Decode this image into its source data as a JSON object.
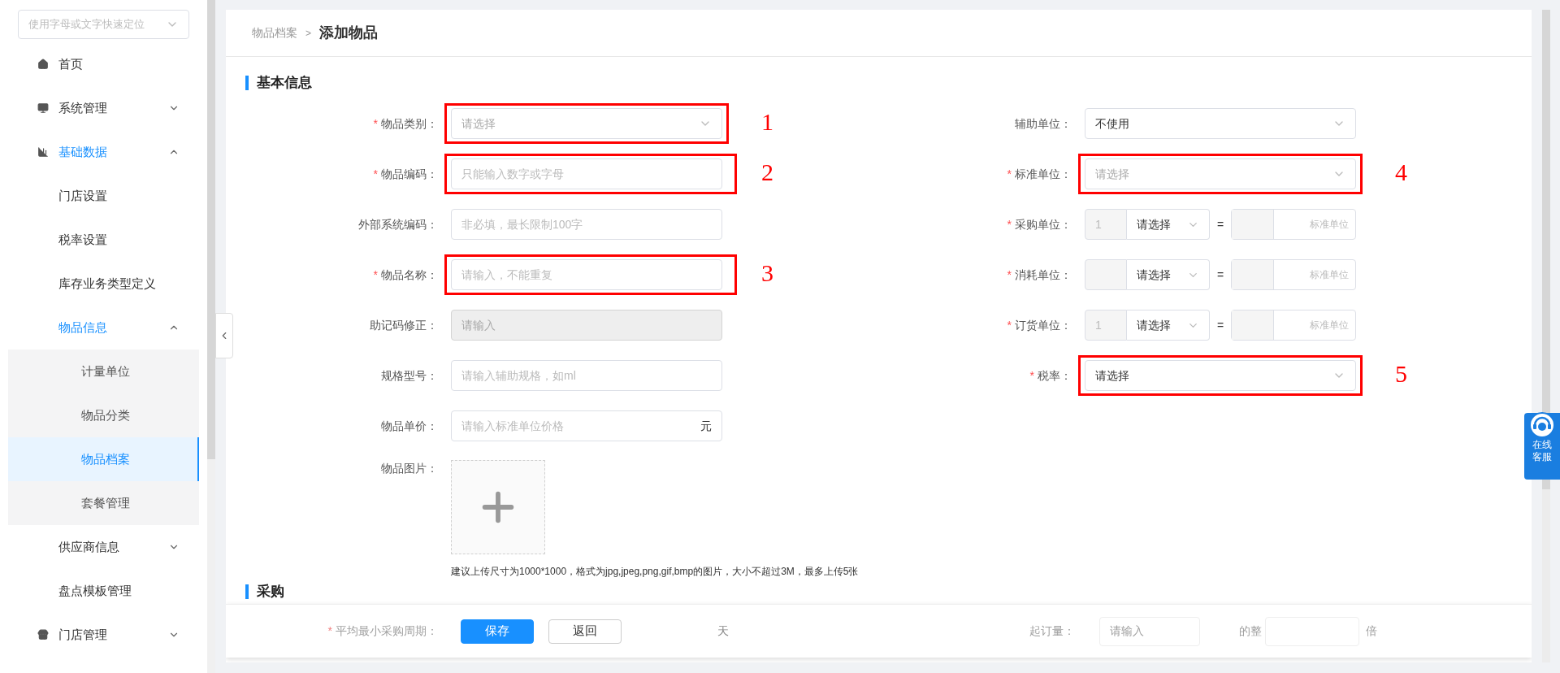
{
  "sidebar": {
    "search": {
      "placeholder": "使用字母或文字快速定位"
    },
    "items": [
      {
        "label": "首页",
        "selected": false
      },
      {
        "label": "系统管理",
        "selected": false,
        "expanded": false
      },
      {
        "label": "基础数据",
        "selected": true,
        "expanded": true,
        "children": [
          {
            "label": "门店设置",
            "selected": false
          },
          {
            "label": "税率设置",
            "selected": false
          },
          {
            "label": "库存业务类型定义",
            "selected": false
          },
          {
            "label": "物品信息",
            "selected": true,
            "expanded": true,
            "children": [
              {
                "label": "计量单位",
                "selected": false
              },
              {
                "label": "物品分类",
                "selected": false
              },
              {
                "label": "物品档案",
                "selected": true
              },
              {
                "label": "套餐管理",
                "selected": false
              }
            ]
          },
          {
            "label": "供应商信息",
            "selected": false,
            "expanded": false
          },
          {
            "label": "盘点模板管理",
            "selected": false
          }
        ]
      },
      {
        "label": "门店管理",
        "selected": false,
        "expanded": false
      }
    ]
  },
  "required_mark": "*",
  "breadcrumb": {
    "parent": "物品档案",
    "separator": ">",
    "current": "添加物品"
  },
  "basic": {
    "title": "基本信息",
    "left_fields": [
      {
        "label": "物品类别：",
        "required": true,
        "kind": "select",
        "placeholder": "请选择",
        "marker": "1"
      },
      {
        "label": "物品编码：",
        "required": true,
        "kind": "input",
        "placeholder": "只能输入数字或字母",
        "marker": "2"
      },
      {
        "label": "外部系统编码：",
        "required": false,
        "kind": "input",
        "placeholder": "非必填，最长限制100字"
      },
      {
        "label": "物品名称：",
        "required": true,
        "kind": "input",
        "placeholder": "请输入，不能重复",
        "marker": "3"
      },
      {
        "label": "助记码修正：",
        "required": false,
        "kind": "input",
        "disabled": true,
        "placeholder": "请输入"
      },
      {
        "label": "规格型号：",
        "required": false,
        "kind": "input",
        "placeholder": "请输入辅助规格，如ml"
      },
      {
        "label": "物品单价：",
        "required": false,
        "kind": "input",
        "placeholder": "请输入标准单位价格",
        "suffix": "元"
      },
      {
        "label": "物品图片：",
        "required": false,
        "kind": "upload",
        "hint": "建议上传尺寸为1000*1000，格式为jpg,jpeg,png,gif,bmp的图片，大小不超过3M，最多上传5张"
      }
    ],
    "right_fields": [
      {
        "label": "辅助单位：",
        "required": false,
        "kind": "select",
        "value": "不使用"
      },
      {
        "label": "标准单位：",
        "required": true,
        "kind": "select",
        "placeholder": "请选择",
        "marker": "4"
      },
      {
        "label": "采购单位：",
        "required": true,
        "kind": "ratio",
        "qty": "1",
        "unit": "请选择",
        "equals": "=",
        "base_hint": "标准单位"
      },
      {
        "label": "消耗单位：",
        "required": true,
        "kind": "ratio",
        "unit": "请选择",
        "equals": "=",
        "base_hint": "标准单位"
      },
      {
        "label": "订货单位：",
        "required": true,
        "kind": "ratio",
        "qty": "1",
        "unit": "请选择",
        "equals": "=",
        "base_hint": "标准单位"
      },
      {
        "label": "税率：",
        "required": true,
        "kind": "select",
        "value": "请选择",
        "marker": "5"
      }
    ]
  },
  "purchase": {
    "title": "采购",
    "cycle": {
      "label": "平均最小采购周期：",
      "required": true,
      "suffix": "天"
    },
    "min_order": {
      "label": "起订量：",
      "placeholder": "请输入"
    },
    "multiple": {
      "label": "的整",
      "suffix": "倍"
    }
  },
  "footer": {
    "buttons": [
      {
        "label": "保存",
        "kind": "primary"
      },
      {
        "label": "返回",
        "kind": "default"
      }
    ]
  },
  "service": {
    "lines": [
      "在线",
      "客服"
    ]
  }
}
